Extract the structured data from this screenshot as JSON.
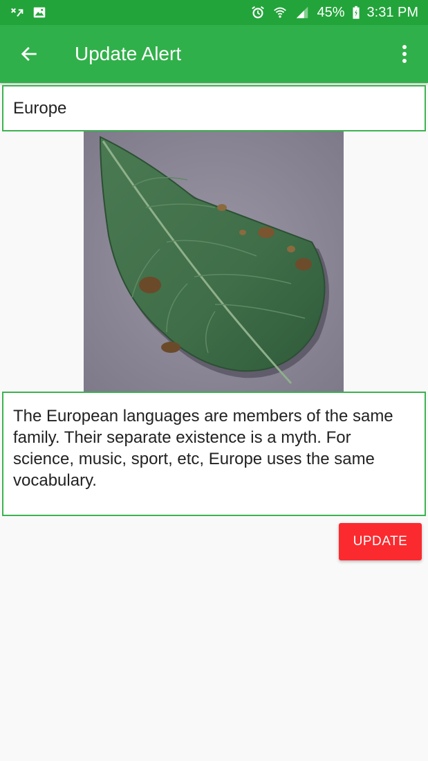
{
  "status_bar": {
    "battery": "45%",
    "time": "3:31 PM",
    "icons_left": [
      "no-signal-icon",
      "image-icon"
    ],
    "icons_right": [
      "alarm-icon",
      "wifi-icon",
      "signal-icon",
      "battery-icon"
    ]
  },
  "app_bar": {
    "title": "Update Alert",
    "back_icon": "arrow-back-icon",
    "overflow_icon": "more-vert-icon"
  },
  "form": {
    "title_value": "Europe",
    "description_value": "The European languages are members of the same family. Their separate existence is a myth. For science, music, sport, etc, Europe uses the same vocabulary.",
    "update_label": "UPDATE"
  },
  "colors": {
    "status_bar": "#22a43a",
    "app_bar": "#30b04a",
    "field_border": "#3bb24f",
    "update_button": "#fb2a2f"
  }
}
